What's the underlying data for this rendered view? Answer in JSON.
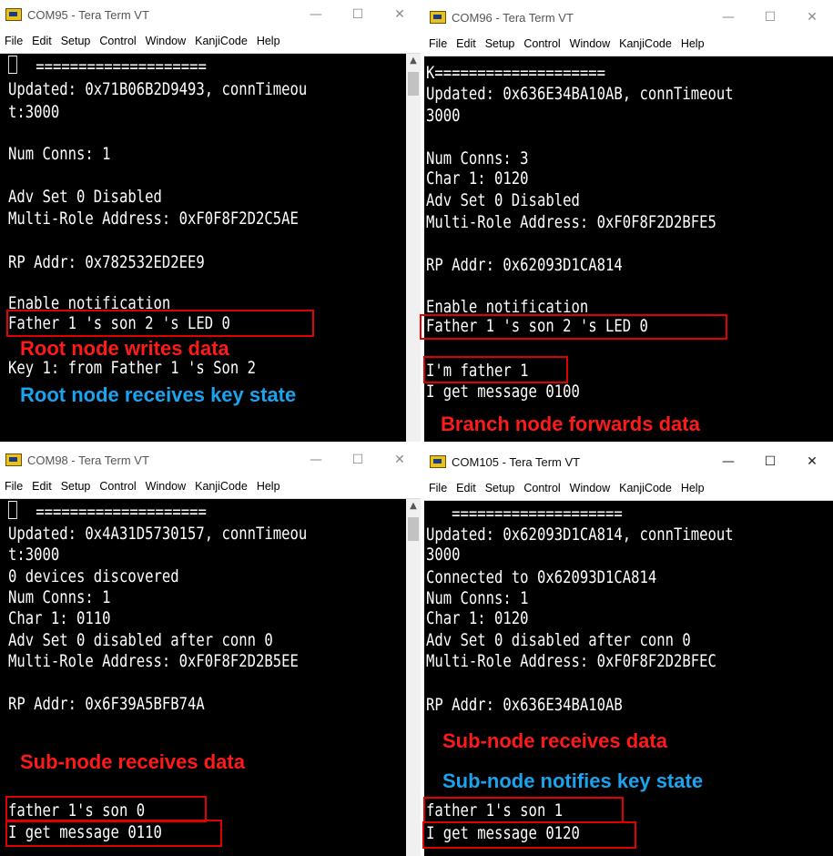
{
  "menu": [
    "File",
    "Edit",
    "Setup",
    "Control",
    "Window",
    "KanjiCode",
    "Help"
  ],
  "controls": {
    "minimize": "—",
    "maximize": "☐",
    "close": "✕"
  },
  "colors": {
    "annotation_red": "#ff1a1a",
    "annotation_blue": "#1aa3ef",
    "box": "#e00000",
    "terminal_bg": "#000000",
    "terminal_fg": "#ffffff"
  },
  "windows": [
    {
      "title": "COM95 - Tera Term VT",
      "lines": [
        "  ====================",
        "Updated: 0x71B06B2D9493, connTimeou",
        "t:3000",
        "",
        "Num Conns: 1",
        "",
        "Adv Set 0 Disabled",
        "Multi-Role Address: 0xF0F8F2D2C5AE",
        "",
        "RP Addr: 0x782532ED2EE9",
        "",
        "Enable notification",
        "Father 1 's son 2 's LED 0",
        "",
        "Key 1: from Father 1 's Son 2"
      ],
      "annotations": [
        "Root node writes data",
        "Root node receives key state"
      ]
    },
    {
      "title": "COM96 - Tera Term VT",
      "lines": [
        "K====================",
        "Updated: 0x636E34BA10AB, connTimeout",
        "3000",
        "",
        "Num Conns: 3",
        "Char 1: 0120",
        "Adv Set 0 Disabled",
        "Multi-Role Address: 0xF0F8F2D2BFE5",
        "",
        "RP Addr: 0x62093D1CA814",
        "",
        "Enable notification",
        "Father 1 's son 2 's LED 0",
        "",
        "I'm father 1",
        "I get message 0100"
      ],
      "annotations": [
        "Branch node forwards data"
      ]
    },
    {
      "title": "COM98 - Tera Term VT",
      "lines": [
        "  ====================",
        "Updated: 0x4A31D5730157, connTimeou",
        "t:3000",
        "0 devices discovered",
        "Num Conns: 1",
        "Char 1: 0110",
        "Adv Set 0 disabled after conn 0",
        "Multi-Role Address: 0xF0F8F2D2B5EE",
        "",
        "RP Addr: 0x6F39A5BFB74A",
        "",
        "",
        "",
        "",
        "father 1's son 0",
        "I get message 0110"
      ],
      "annotations": [
        "Sub-node receives data"
      ]
    },
    {
      "title": "COM105 - Tera Term VT",
      "lines": [
        "   ====================",
        "Updated: 0x62093D1CA814, connTimeout",
        "3000",
        "Connected to 0x62093D1CA814",
        "Num Conns: 1",
        "Char 1: 0120",
        "Adv Set 0 disabled after conn 0",
        "Multi-Role Address: 0xF0F8F2D2BFEC",
        "",
        "RP Addr: 0x636E34BA10AB",
        "",
        "",
        "",
        "father 1's son 1",
        "I get message 0120"
      ],
      "annotations": [
        "Sub-node receives data",
        "Sub-node notifies key state"
      ]
    }
  ]
}
